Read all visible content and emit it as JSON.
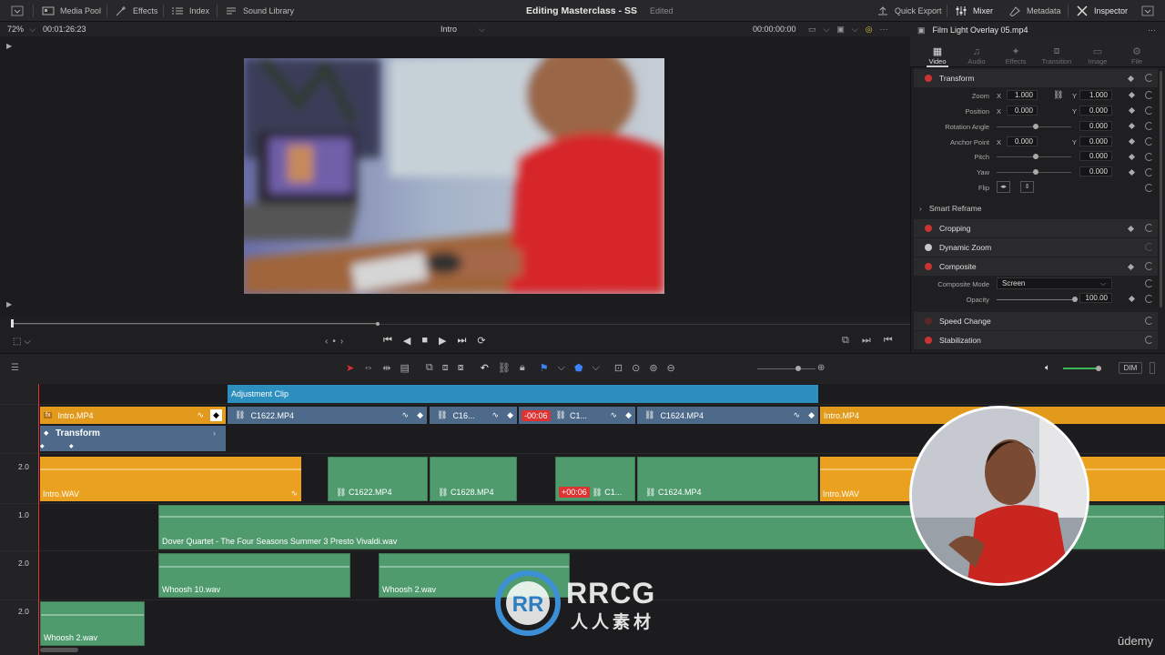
{
  "topbar": {
    "media_pool": "Media Pool",
    "effects": "Effects",
    "index": "Index",
    "sound_library": "Sound Library",
    "project_title": "Editing Masterclass - SS",
    "project_status": "Edited",
    "quick_export": "Quick Export",
    "mixer": "Mixer",
    "metadata": "Metadata",
    "inspector": "Inspector"
  },
  "viewer": {
    "zoom": "72%",
    "timecode_left": "00:01:26:23",
    "timeline_name": "Intro",
    "timecode_right": "00:00:00:00"
  },
  "inspector": {
    "clip_name": "Film Light Overlay 05.mp4",
    "tabs": [
      "Video",
      "Audio",
      "Effects",
      "Transition",
      "Image",
      "File"
    ],
    "transform": {
      "title": "Transform",
      "zoom_label": "Zoom",
      "zoom_x": "1.000",
      "zoom_y": "1.000",
      "position_label": "Position",
      "position_x": "0.000",
      "position_y": "0.000",
      "rotation_label": "Rotation Angle",
      "rotation": "0.000",
      "anchor_label": "Anchor Point",
      "anchor_x": "0.000",
      "anchor_y": "0.000",
      "pitch_label": "Pitch",
      "pitch": "0.000",
      "yaw_label": "Yaw",
      "yaw": "0.000",
      "flip_label": "Flip",
      "x": "X",
      "y": "Y"
    },
    "smart_reframe": "Smart Reframe",
    "cropping": "Cropping",
    "dynamic_zoom": "Dynamic Zoom",
    "composite": {
      "title": "Composite",
      "mode_label": "Composite Mode",
      "mode_value": "Screen",
      "opacity_label": "Opacity",
      "opacity_value": "100.00"
    },
    "speed_change": "Speed Change",
    "stabilization": "Stabilization"
  },
  "toolbar": {
    "dim": "DIM"
  },
  "timeline": {
    "adjustment_clip": "Adjustment Clip",
    "v1_clips": {
      "intro": "Intro.MP4",
      "c1622": "C1622.MP4",
      "c16": "C16...",
      "offset": "-00:06",
      "c1": "C1...",
      "c1624": "C1624.MP4",
      "intro_end": "Intro.MP4"
    },
    "transform_label": "Transform",
    "a1": {
      "level": "2.0",
      "intro": "Intro.WAV",
      "c1622": "C1622.MP4",
      "c1628": "C1628.MP4",
      "offset": "+00:06",
      "c1": "C1...",
      "c1624": "C1624.MP4",
      "intro_end": "Intro.WAV"
    },
    "a2": {
      "level": "1.0",
      "music": "Dover Quartet - The Four Seasons Summer 3 Presto Vivaldi.wav"
    },
    "a3": {
      "level": "2.0",
      "whoosh10": "Whoosh 10.wav",
      "whoosh2": "Whoosh 2.wav"
    },
    "a4": {
      "level": "2.0",
      "whoosh2": "Whoosh 2.wav"
    }
  },
  "watermark": {
    "brand": "RRCG",
    "brand_cn": "人人素材",
    "udemy": "ūdemy"
  }
}
